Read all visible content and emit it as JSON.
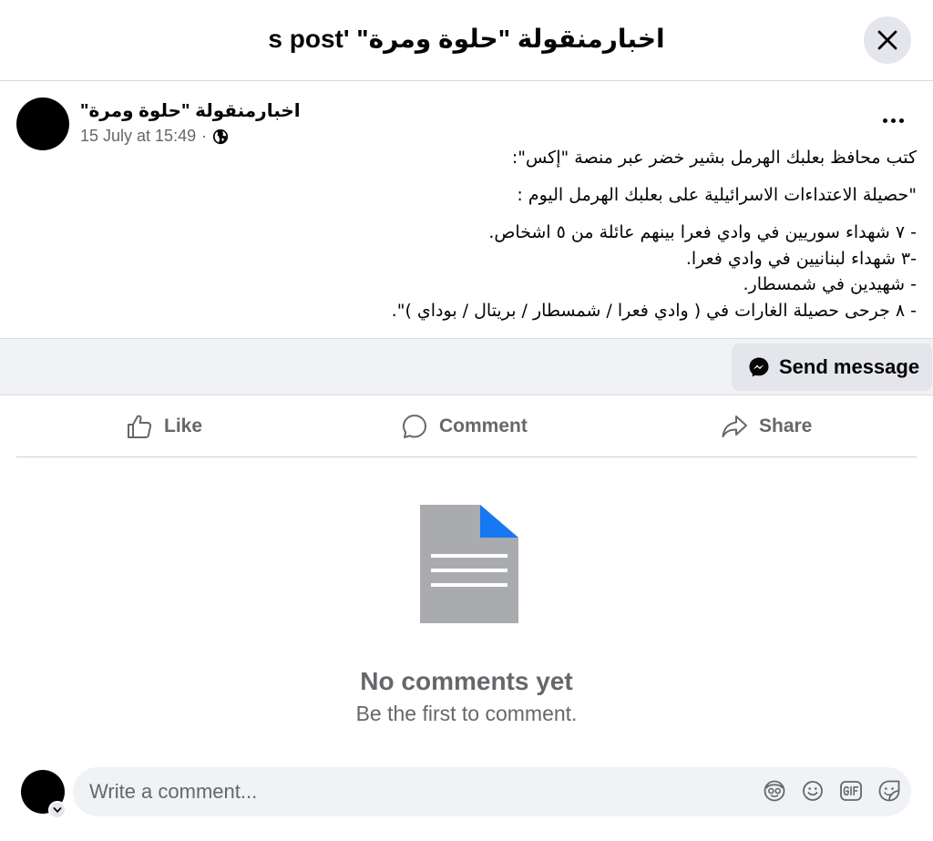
{
  "header": {
    "title": "اخبارمنقولة \"حلوة ومرة\" 's post"
  },
  "post": {
    "author": "اخبارمنقولة \"حلوة ومرة\"",
    "timestamp": "15 July at 15:49",
    "separator": "·",
    "privacy_icon": "globe-icon",
    "paragraph1": "كتب محافظ بعلبك الهرمل بشير خضر عبر منصة \"إكس\":",
    "paragraph2": "\"حصيلة الاعتداءات الاسرائيلية على بعلبك الهرمل اليوم :",
    "lines": [
      "- ٧ شهداء سوريين في وادي فعرا بينهم عائلة من ٥ اشخاص.",
      "-٣ شهداء لبنانيين في وادي فعرا.",
      "- شهيدين في شمسطار.",
      "- ٨ جرحى حصيلة الغارات في ( وادي فعرا / شمسطار / بريتال / بوداي )\"."
    ]
  },
  "message_bar": {
    "send_message_label": "Send message",
    "icon": "messenger-icon"
  },
  "actions": {
    "like_label": "Like",
    "comment_label": "Comment",
    "share_label": "Share"
  },
  "empty_state": {
    "title": "No comments yet",
    "subtitle": "Be the first to comment."
  },
  "composer": {
    "placeholder": "Write a comment...",
    "icons": [
      "avatar-sticker-icon",
      "emoji-icon",
      "gif-icon",
      "sticker-icon"
    ]
  },
  "colors": {
    "accent": "#1877f2",
    "secondary_text": "#65676b",
    "surface": "#f0f2f5",
    "button_bg": "#e4e6eb"
  }
}
